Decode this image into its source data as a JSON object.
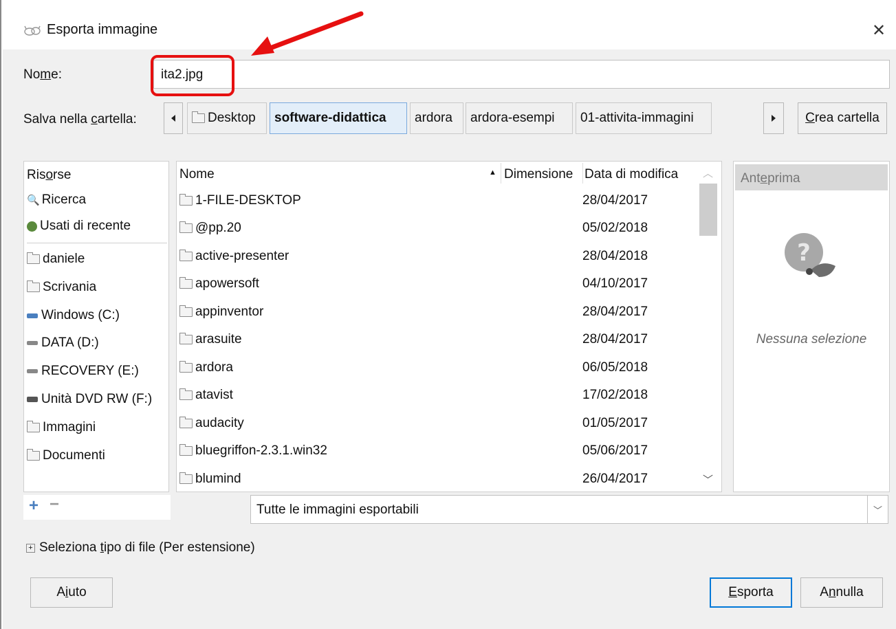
{
  "window": {
    "title": "Esporta immagine",
    "close_glyph": "✕"
  },
  "name": {
    "label": "Nome:",
    "value": "ita2.jpg"
  },
  "folder": {
    "label": "Salva nella cartella:",
    "crumbs": [
      "Desktop",
      "software-didattica",
      "ardora",
      "ardora-esempi",
      "01-attivita-immagini"
    ],
    "create_label": "Crea cartella"
  },
  "sidebar": {
    "header": "Risorse",
    "items": [
      "Ricerca",
      "Usati di recente",
      "daniele",
      "Scrivania",
      "Windows (C:)",
      "DATA (D:)",
      "RECOVERY (E:)",
      "Unità DVD RW (F:)",
      "Immagini",
      "Documenti"
    ]
  },
  "filelist": {
    "columns": {
      "name": "Nome",
      "size": "Dimensione",
      "date": "Data di modifica"
    },
    "rows": [
      {
        "name": "1-FILE-DESKTOP",
        "date": "28/04/2017"
      },
      {
        "name": "@pp.20",
        "date": "05/02/2018"
      },
      {
        "name": "active-presenter",
        "date": "28/04/2018"
      },
      {
        "name": "apowersoft",
        "date": "04/10/2017"
      },
      {
        "name": "appinventor",
        "date": "28/04/2017"
      },
      {
        "name": "arasuite",
        "date": "28/04/2017"
      },
      {
        "name": "ardora",
        "date": "06/05/2018"
      },
      {
        "name": "atavist",
        "date": "17/02/2018"
      },
      {
        "name": "audacity",
        "date": "01/05/2017"
      },
      {
        "name": "bluegriffon-2.3.1.win32",
        "date": "05/06/2017"
      },
      {
        "name": "blumind",
        "date": "26/04/2017"
      }
    ]
  },
  "preview": {
    "title": "Anteprima",
    "empty": "Nessuna selezione"
  },
  "filter": {
    "value": "Tutte le immagini esportabili"
  },
  "filetype": {
    "label": "Seleziona tipo di file (Per estensione)"
  },
  "buttons": {
    "help": "Aiuto",
    "export": "Esporta",
    "cancel": "Annulla"
  },
  "colors": {
    "annotation": "#e61010",
    "selected_crumb": "#e3eef9",
    "accent": "#0078d7"
  }
}
